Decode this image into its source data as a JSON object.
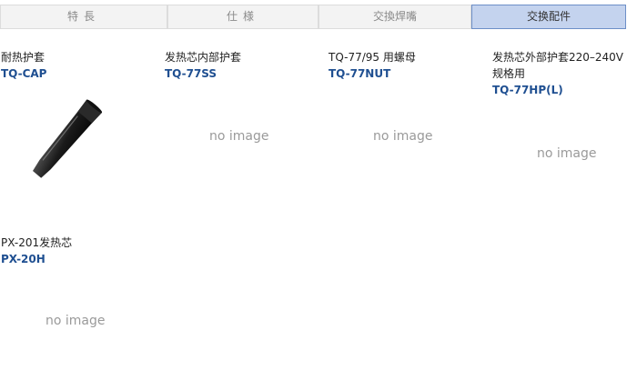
{
  "tabs": [
    {
      "label": "特長"
    },
    {
      "label": "仕様"
    },
    {
      "label": "交換焊嘴"
    },
    {
      "label": "交换配件"
    }
  ],
  "items": [
    {
      "name": "耐热护套",
      "code": "TQ-CAP"
    },
    {
      "name": "发热芯内部护套",
      "code": "TQ-77SS",
      "image_text": "no image"
    },
    {
      "name": "TQ-77/95 用螺母",
      "code": "TQ-77NUT",
      "image_text": "no image"
    },
    {
      "name": "发热芯外部护套220–240V 规格用",
      "code": "TQ-77HP(L)",
      "image_text": "no image"
    },
    {
      "name": "PX-201发热芯",
      "code": "PX-20H",
      "image_text": "no image"
    }
  ],
  "colors": {
    "active_tab_bg": "#c4d3ee",
    "active_tab_border": "#6d8fc7",
    "code_link": "#1f4f91"
  }
}
